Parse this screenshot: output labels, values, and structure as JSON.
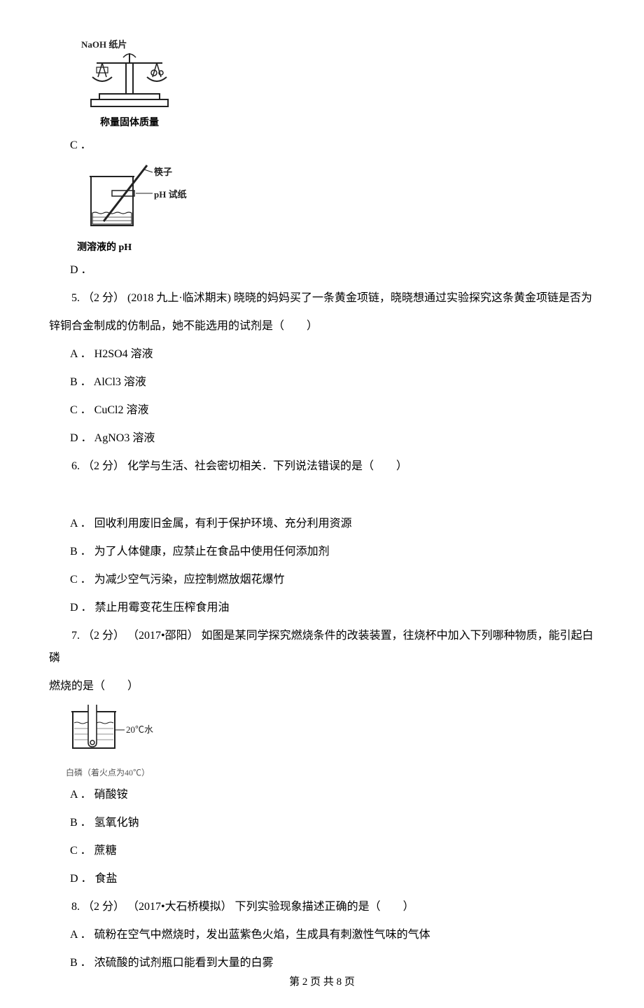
{
  "figC": {
    "label_top": "NaOH 纸片",
    "caption": "称量固体质量",
    "optLabel": "C ．"
  },
  "figD": {
    "label_chopstick": "筷子",
    "label_paper": "pH 试纸",
    "caption": "测溶液的 pH",
    "optLabel": "D ．"
  },
  "q5": {
    "stem": "5. （2 分） (2018 九上·临沭期末) 晓晓的妈妈买了一条黄金项链，晓晓想通过实验探究这条黄金项链是否为",
    "stem2": "锌铜合金制成的仿制品，她不能选用的试剂是（　　）",
    "A": "A ． H2SO4 溶液",
    "B": "B ． AlCl3 溶液",
    "C": "C ． CuCl2 溶液",
    "D": "D ． AgNO3 溶液"
  },
  "q6": {
    "stem": "6. （2 分）  化学与生活、社会密切相关．下列说法错误的是（　　）",
    "A": "A ． 回收利用废旧金属，有利于保护环境、充分利用资源",
    "B": "B ． 为了人体健康，应禁止在食品中使用任何添加剂",
    "C": "C ． 为减少空气污染，应控制燃放烟花爆竹",
    "D": "D ． 禁止用霉变花生压榨食用油"
  },
  "q7": {
    "stem": "7. （2 分） （2017•邵阳） 如图是某同学探究燃烧条件的改装装置，往烧杯中加入下列哪种物质，能引起白磷",
    "stem2": "燃烧的是（　　）",
    "fig_label_temp": "20℃水",
    "fig_label_baiphos": "白磷（着火点为40℃）",
    "A": "A ． 硝酸铵",
    "B": "B ． 氢氧化钠",
    "C": "C ． 蔗糖",
    "D": "D ． 食盐"
  },
  "q8": {
    "stem": "8. （2 分） （2017•大石桥模拟） 下列实验现象描述正确的是（　　）",
    "A": "A ． 硫粉在空气中燃烧时，发出蓝紫色火焰，生成具有刺激性气味的气体",
    "B": "B ． 浓硫酸的试剂瓶口能看到大量的白雾"
  },
  "footer": "第 2 页 共 8 页"
}
